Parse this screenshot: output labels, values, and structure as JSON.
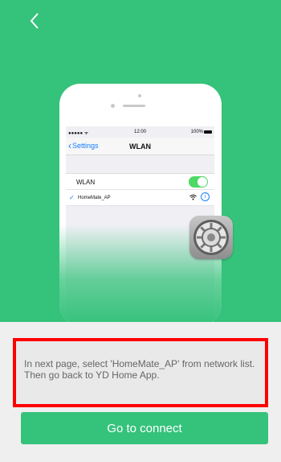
{
  "colors": {
    "hero_bg": "#35c27b",
    "accent_blue": "#147efb",
    "toggle_on": "#4cd964",
    "highlight_border": "#ff0000"
  },
  "header": {
    "back_icon": "chevron-left-icon"
  },
  "phone": {
    "status_bar": {
      "signal": "●●●●● ᯤ",
      "time": "12:00",
      "battery": "100%"
    },
    "nav": {
      "back_label": "Settings",
      "title": "WLAN"
    },
    "wlan_toggle": {
      "label": "WLAN",
      "on": true
    },
    "network": {
      "name": "HomeMate_AP",
      "connected": true
    }
  },
  "settings_icon": "settings-gear-icon",
  "instruction": {
    "text": "In next page, select 'HomeMate_AP' from network list. Then go back to YD Home App."
  },
  "connect_button": {
    "label": "Go to connect"
  }
}
